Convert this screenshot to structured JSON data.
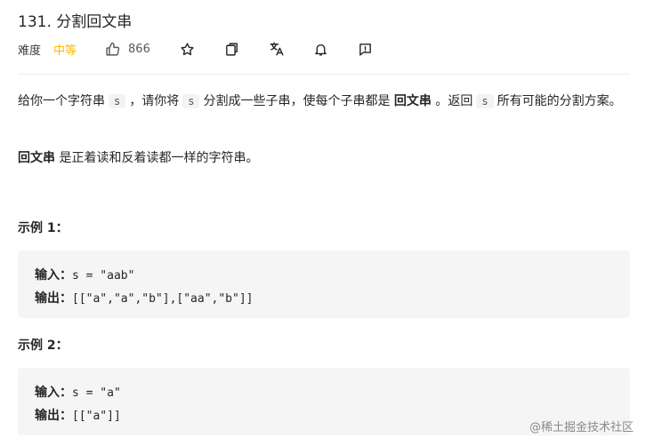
{
  "problem": {
    "title": "131. 分割回文串",
    "difficulty_label": "难度",
    "difficulty_value": "中等",
    "likes": "866"
  },
  "description": {
    "p1_a": "给你一个字符串",
    "p1_code1": "s",
    "p1_b": "，请你将",
    "p1_code2": "s",
    "p1_c": "分割成一些子串，使每个子串都是",
    "p1_bold": "回文串",
    "p1_d": "。返回",
    "p1_code3": "s",
    "p1_e": "所有可能的分割方案。",
    "p2_bold": "回文串",
    "p2_rest": "是正着读和反着读都一样的字符串。"
  },
  "examples": [
    {
      "title": "示例 1：",
      "input_label": "输入：",
      "input_value": "s = \"aab\"",
      "output_label": "输出：",
      "output_value": "[[\"a\",\"a\",\"b\"],[\"aa\",\"b\"]]"
    },
    {
      "title": "示例 2：",
      "input_label": "输入：",
      "input_value": "s = \"a\"",
      "output_label": "输出：",
      "output_value": "[[\"a\"]]"
    }
  ],
  "watermark": "@稀土掘金技术社区",
  "colors": {
    "difficulty_medium": "#ffb800",
    "code_bg": "#f5f5f5",
    "text": "#262626"
  },
  "toolbar_icons": [
    "thumbs-up-icon",
    "star-icon",
    "share-icon",
    "translate-icon",
    "bell-icon",
    "feedback-icon"
  ]
}
